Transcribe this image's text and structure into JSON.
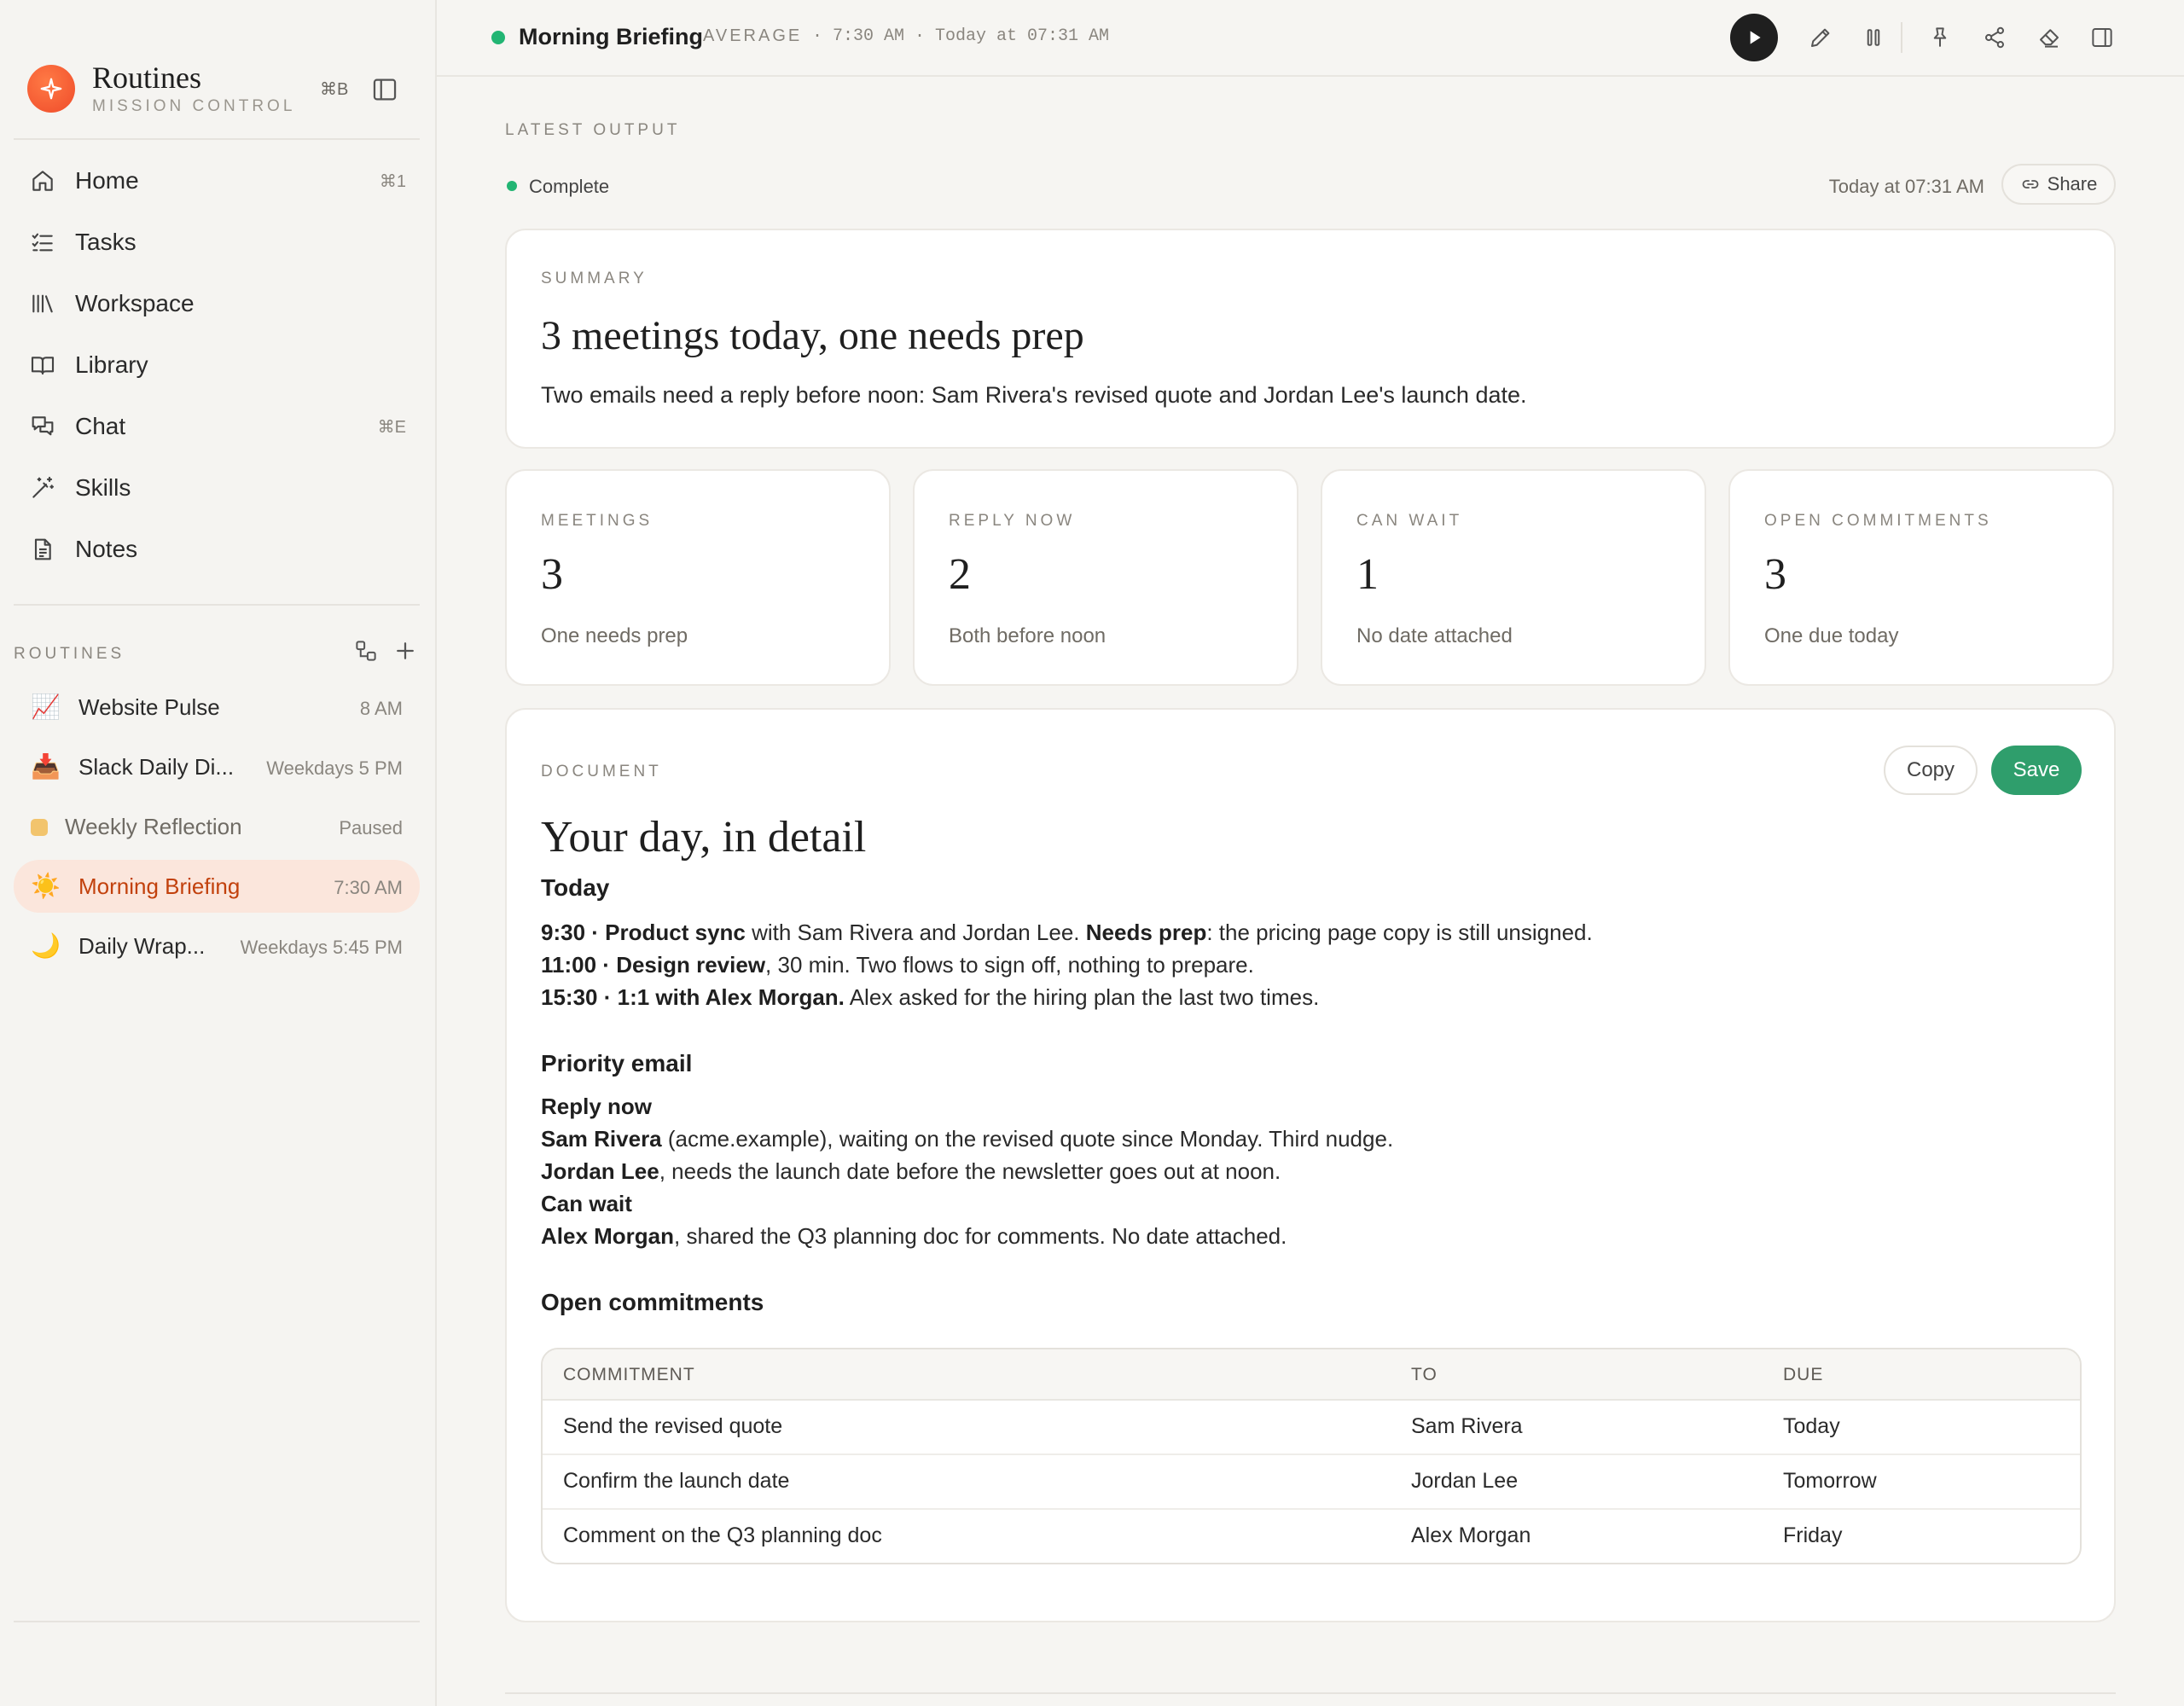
{
  "sidebar": {
    "brand": {
      "title": "Routines",
      "subtitle": "MISSION CONTROL",
      "shortcut": "⌘B",
      "logo_icon": "sparkle-icon"
    },
    "nav": [
      {
        "label": "Home",
        "icon": "home-icon",
        "shortcut": "⌘1"
      },
      {
        "label": "Tasks",
        "icon": "checklist-icon",
        "shortcut": ""
      },
      {
        "label": "Workspace",
        "icon": "library-books-icon",
        "shortcut": ""
      },
      {
        "label": "Library",
        "icon": "book-open-icon",
        "shortcut": ""
      },
      {
        "label": "Chat",
        "icon": "chat-bubbles-icon",
        "shortcut": "⌘E"
      },
      {
        "label": "Skills",
        "icon": "magic-wand-icon",
        "shortcut": ""
      },
      {
        "label": "Notes",
        "icon": "document-icon",
        "shortcut": ""
      }
    ],
    "routines_label": "ROUTINES",
    "routines": [
      {
        "emoji": "📈",
        "name": "Website Pulse",
        "schedule": "8 AM",
        "state": "active"
      },
      {
        "emoji": "📥",
        "name": "Slack Daily Di...",
        "schedule": "Weekdays 5 PM",
        "state": "active"
      },
      {
        "emoji": "",
        "name": "Weekly Reflection",
        "schedule": "Paused",
        "state": "paused",
        "dot_color": "#f2c46d"
      },
      {
        "emoji": "☀️",
        "name": "Morning Briefing",
        "schedule": "7:30 AM",
        "state": "selected"
      },
      {
        "emoji": "🌙",
        "name": "Daily Wrap...",
        "schedule": "Weekdays 5:45 PM",
        "state": "active"
      }
    ]
  },
  "topbar": {
    "title": "Morning Briefing",
    "badge": "AVERAGE",
    "meta": "· 7:30 AM · Today at 07:31 AM",
    "status_color": "#22b573",
    "actions": [
      "play-icon",
      "pencil-icon",
      "pause-icon",
      "pin-icon",
      "share-nodes-icon",
      "eraser-icon",
      "panel-right-icon"
    ]
  },
  "output": {
    "section_label": "LATEST OUTPUT",
    "status": "Complete",
    "timestamp": "Today at 07:31 AM",
    "share_label": "Share"
  },
  "summary": {
    "label": "SUMMARY",
    "headline": "3 meetings today, one needs prep",
    "text": "Two emails need a reply before noon: Sam Rivera's revised quote and Jordan Lee's launch date."
  },
  "stats": [
    {
      "label": "MEETINGS",
      "value": "3",
      "sub": "One needs prep"
    },
    {
      "label": "REPLY NOW",
      "value": "2",
      "sub": "Both before noon"
    },
    {
      "label": "CAN WAIT",
      "value": "1",
      "sub": "No date attached"
    },
    {
      "label": "OPEN COMMITMENTS",
      "value": "3",
      "sub": "One due today"
    }
  ],
  "document": {
    "label": "DOCUMENT",
    "copy_label": "Copy",
    "save_label": "Save",
    "title": "Your day, in detail",
    "today_heading": "Today",
    "meetings": [
      {
        "time": "9:30",
        "title": "Product sync",
        "rest": " with Sam Rivera and Jordan Lee. ",
        "flag": "Needs prep",
        "after": ": the pricing page copy is still unsigned."
      },
      {
        "time": "11:00",
        "title": "Design review",
        "rest": ", 30 min. Two flows to sign off, nothing to prepare.",
        "flag": "",
        "after": ""
      },
      {
        "time": "15:30",
        "title": "1:1 with Alex Morgan.",
        "rest": " Alex asked for the hiring plan the last two times.",
        "flag": "",
        "after": ""
      }
    ],
    "email_heading": "Priority email",
    "reply_now_label": "Reply now",
    "reply_now": [
      {
        "name": "Sam Rivera",
        "text": " (acme.example), waiting on the revised quote since Monday. Third nudge."
      },
      {
        "name": "Jordan Lee",
        "text": ", needs the launch date before the newsletter goes out at noon."
      }
    ],
    "can_wait_label": "Can wait",
    "can_wait": [
      {
        "name": "Alex Morgan",
        "text": ", shared the Q3 planning doc for comments. No date attached."
      }
    ],
    "commitments_heading": "Open commitments",
    "table": {
      "headers": [
        "COMMITMENT",
        "TO",
        "DUE"
      ],
      "rows": [
        [
          "Send the revised quote",
          "Sam Rivera",
          "Today"
        ],
        [
          "Confirm the launch date",
          "Jordan Lee",
          "Tomorrow"
        ],
        [
          "Comment on the Q3 planning doc",
          "Alex Morgan",
          "Friday"
        ]
      ]
    }
  }
}
